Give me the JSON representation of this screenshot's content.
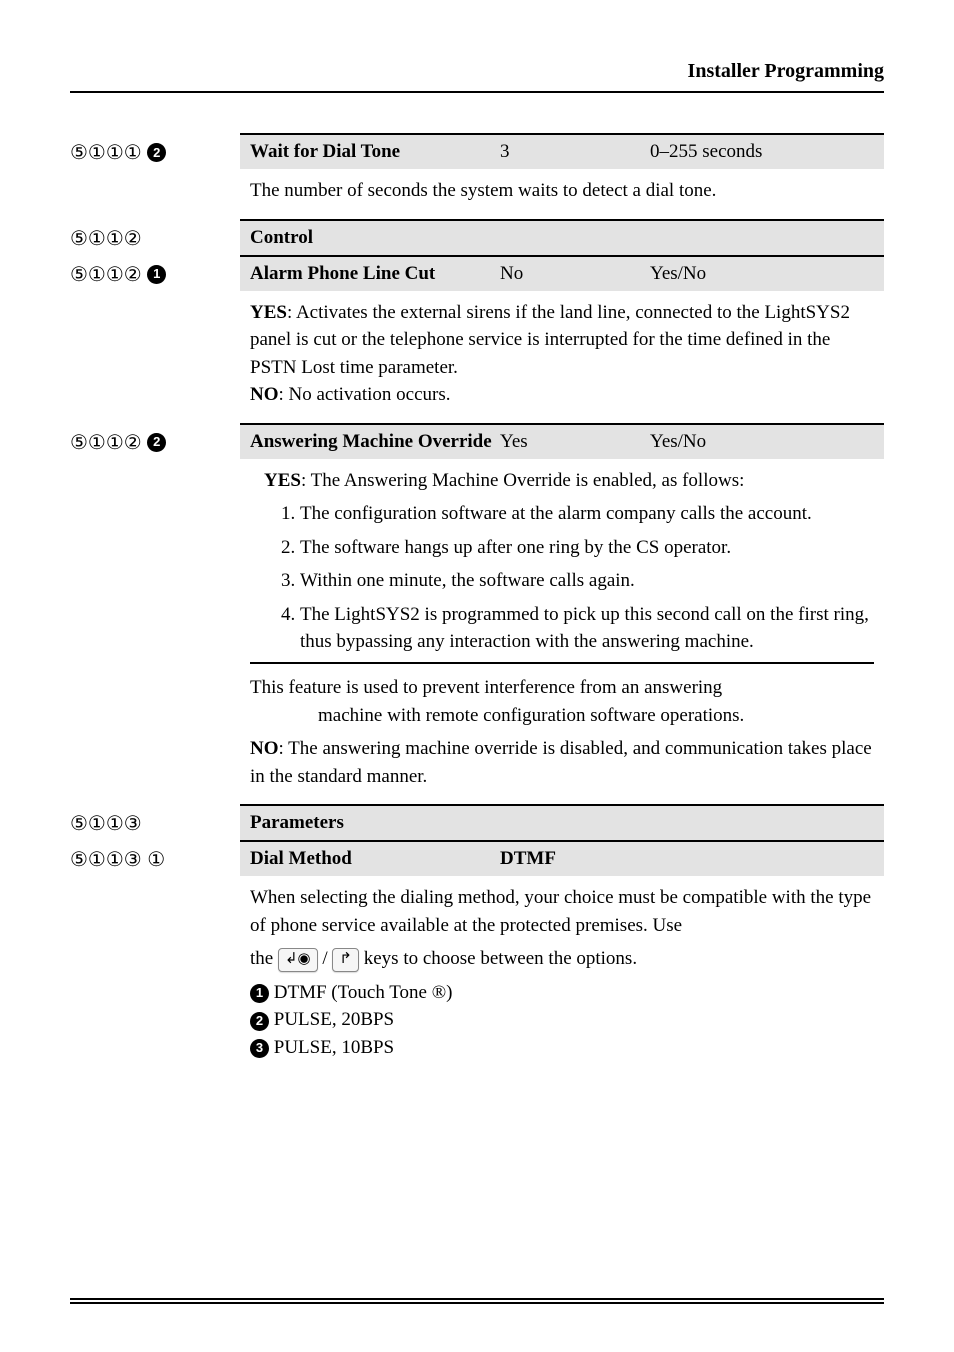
{
  "header": {
    "title": "Installer Programming"
  },
  "rows": [
    {
      "code_circled": "⑤①①①",
      "code_solid": "2",
      "title": "Wait for Dial Tone",
      "default": "3",
      "range": "0–255 seconds",
      "desc_plain": "The number of seconds the system waits to detect a dial tone."
    },
    {
      "code_circled": "⑤①①②",
      "section": "Control"
    },
    {
      "code_circled": "⑤①①②",
      "code_solid": "1",
      "title": "Alarm Phone Line Cut",
      "default": "No",
      "range": "Yes/No",
      "desc_parts": {
        "yes_label": "YES",
        "yes_text": ": Activates the external sirens if the land line, connected to the LightSYS2 panel is cut or the telephone service is interrupted for the time defined in the PSTN Lost time parameter.",
        "no_label": "NO",
        "no_text": ": No activation occurs."
      }
    },
    {
      "code_circled": "⑤①①②",
      "code_solid": "2",
      "title": "Answering Machine Override",
      "default": "Yes",
      "range": "Yes/No",
      "amo": {
        "yes_label": "YES",
        "yes_intro": ": The Answering Machine Override is enabled, as follows:",
        "items": [
          "The configuration software at the alarm company calls the account.",
          "The software hangs up after one ring by the CS operator.",
          "Within one minute, the software calls again.",
          "The LightSYS2 is programmed to pick up this second call on the first ring, thus bypassing any interaction with the answering machine."
        ],
        "note1a": "This feature is used to prevent interference from an answering",
        "note1b": "machine with remote configuration software operations.",
        "no_label": "NO",
        "no_text": ": The answering machine override is disabled, and communication takes place in the standard manner."
      }
    },
    {
      "code_circled": "⑤①①③",
      "section": "Parameters"
    },
    {
      "code_circled": "⑤①①③",
      "code_trail": "①",
      "title": "Dial Method",
      "default": "DTMF",
      "range": "",
      "dial": {
        "intro": "When selecting the dialing method, your choice must be compatible with the type of phone service available at the protected premises.  Use",
        "prefix": "the ",
        "key1": "↲◉",
        "slash": " / ",
        "key2": "↱",
        "suffix": " keys  to choose between the options.",
        "opts": [
          {
            "n": "1",
            "text": " DTMF (Touch Tone ®)"
          },
          {
            "n": "2",
            "text": " PULSE, 20BPS"
          },
          {
            "n": "3",
            "text": " PULSE, 10BPS"
          }
        ]
      }
    }
  ]
}
